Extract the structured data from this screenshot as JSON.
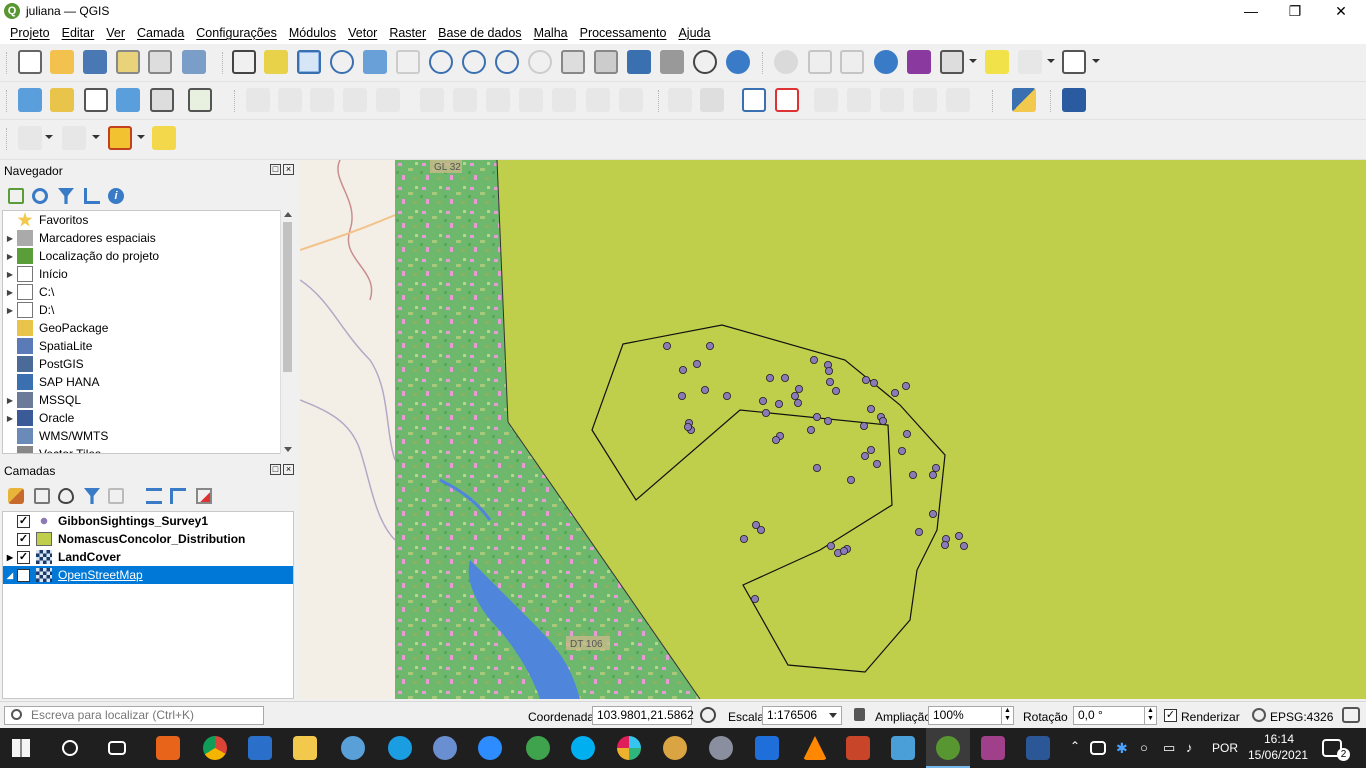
{
  "window": {
    "title": "juliana — QGIS",
    "controls": [
      "minimize-icon",
      "maximize-icon",
      "close-icon"
    ]
  },
  "menu": [
    "Projeto",
    "Editar",
    "Ver",
    "Camada",
    "Configurações",
    "Módulos",
    "Vetor",
    "Raster",
    "Base de dados",
    "Malha",
    "Processamento",
    "Ajuda"
  ],
  "navigator": {
    "title": "Navegador",
    "items": [
      {
        "label": "Favoritos",
        "icon": "star-icon",
        "expandable": false
      },
      {
        "label": "Marcadores espaciais",
        "icon": "bookmark-icon",
        "expandable": true
      },
      {
        "label": "Localização do projeto",
        "icon": "project-home-icon",
        "expandable": true
      },
      {
        "label": "Início",
        "icon": "home-folder-icon",
        "expandable": true
      },
      {
        "label": "C:\\",
        "icon": "drive-icon",
        "expandable": true
      },
      {
        "label": "D:\\",
        "icon": "drive-icon",
        "expandable": true
      },
      {
        "label": "GeoPackage",
        "icon": "geopackage-icon",
        "expandable": false
      },
      {
        "label": "SpatiaLite",
        "icon": "spatialite-icon",
        "expandable": false
      },
      {
        "label": "PostGIS",
        "icon": "postgis-icon",
        "expandable": false
      },
      {
        "label": "SAP HANA",
        "icon": "sap-hana-icon",
        "expandable": false
      },
      {
        "label": "MSSQL",
        "icon": "mssql-icon",
        "expandable": true
      },
      {
        "label": "Oracle",
        "icon": "oracle-icon",
        "expandable": true
      },
      {
        "label": "WMS/WMTS",
        "icon": "wms-icon",
        "expandable": false
      },
      {
        "label": "Vector Tiles",
        "icon": "vector-tiles-icon",
        "expandable": false
      }
    ]
  },
  "layers_panel": {
    "title": "Camadas",
    "layers": [
      {
        "name": "GibbonSightings_Survey1",
        "checked": true,
        "symbol": "point",
        "expandable": false,
        "selected": false
      },
      {
        "name": "NomascusConcolor_Distribution",
        "checked": true,
        "symbol": "fill",
        "expandable": false,
        "selected": false
      },
      {
        "name": "LandCover",
        "checked": true,
        "symbol": "raster",
        "expandable": true,
        "selected": false
      },
      {
        "name": "OpenStreetMap",
        "checked": true,
        "symbol": "raster",
        "expandable": true,
        "selected": true
      }
    ]
  },
  "map": {
    "labels": [
      "GL 32",
      "DT 106"
    ],
    "colors": {
      "distribution_fill": "#bfcf4b",
      "point_fill": "#8c7ab8",
      "forest": "#6bb86b",
      "water": "#4f86dc",
      "osm_bg": "#f4efe6"
    }
  },
  "status": {
    "locator_placeholder": "Escreva para localizar (Ctrl+K)",
    "coordinate_label": "Coordenada",
    "coordinate": "103.9801,21.5862",
    "scale_label": "Escala",
    "scale": "1:176506",
    "zoom_label": "Ampliação",
    "zoom": "100%",
    "rotation_label": "Rotação",
    "rotation": "0,0 °",
    "render_label": "Renderizar",
    "render_checked": true,
    "crs": "EPSG:4326"
  },
  "taskbar": {
    "language": "POR",
    "time": "16:14",
    "date": "15/06/2021",
    "notifications": "2"
  }
}
